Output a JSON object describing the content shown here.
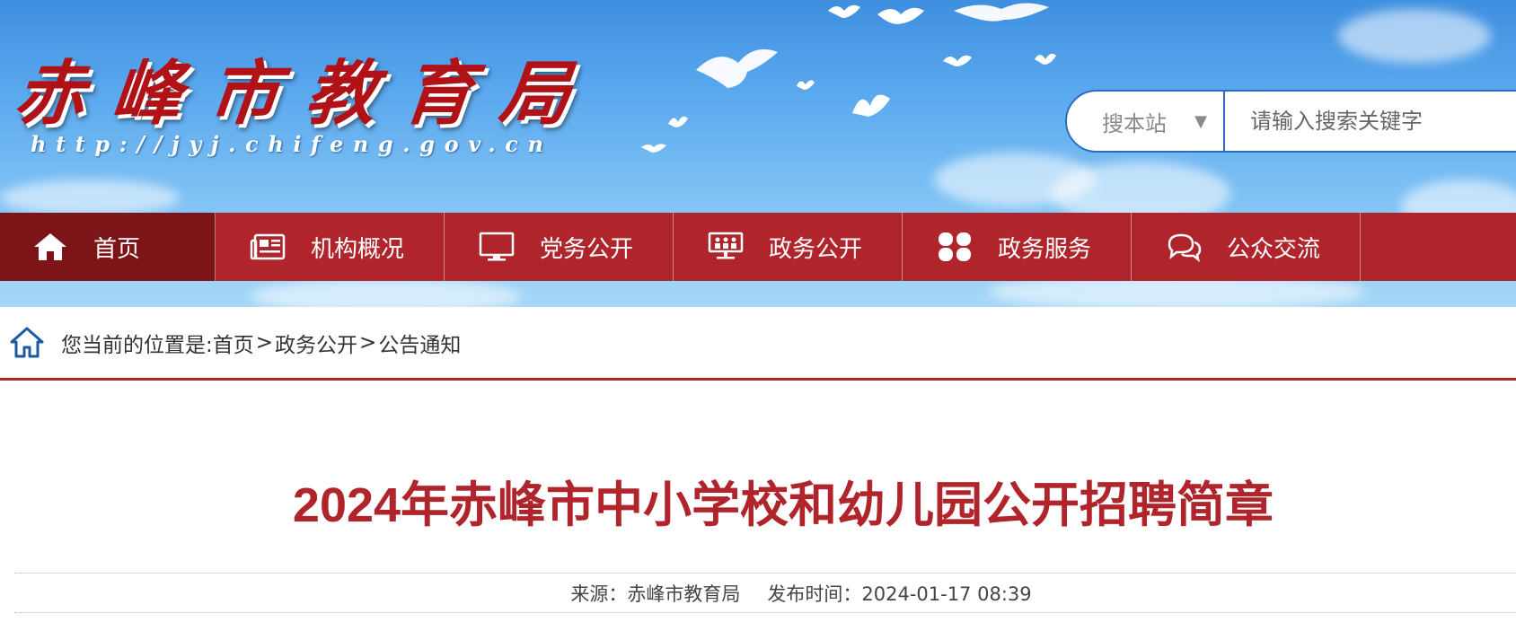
{
  "header": {
    "site_title": "赤峰市教育局",
    "site_url": "http://jyj.chifeng.gov.cn"
  },
  "search": {
    "scope_label": "搜本站",
    "scope_caret": "▼",
    "placeholder": "请输入搜索关键字"
  },
  "nav": {
    "items": [
      {
        "label": "首页",
        "icon": "home-icon"
      },
      {
        "label": "机构概况",
        "icon": "newspaper-icon"
      },
      {
        "label": "党务公开",
        "icon": "monitor-icon"
      },
      {
        "label": "政务公开",
        "icon": "meeting-icon"
      },
      {
        "label": "政务服务",
        "icon": "clover-icon"
      },
      {
        "label": "公众交流",
        "icon": "chat-icon"
      }
    ]
  },
  "breadcrumb": {
    "prefix": "您当前的位置是:",
    "items": [
      "首页",
      "政务公开",
      "公告通知"
    ],
    "separator": ">"
  },
  "article": {
    "title": "2024年赤峰市中小学校和幼儿园公开招聘简章",
    "source": "来源：赤峰市教育局",
    "published": "发布时间：2024-01-17 08:39"
  },
  "colors": {
    "nav_bg": "#b0252c",
    "nav_active": "#7c1418",
    "title_red": "#b0252c",
    "search_border": "#2a6cc1"
  }
}
